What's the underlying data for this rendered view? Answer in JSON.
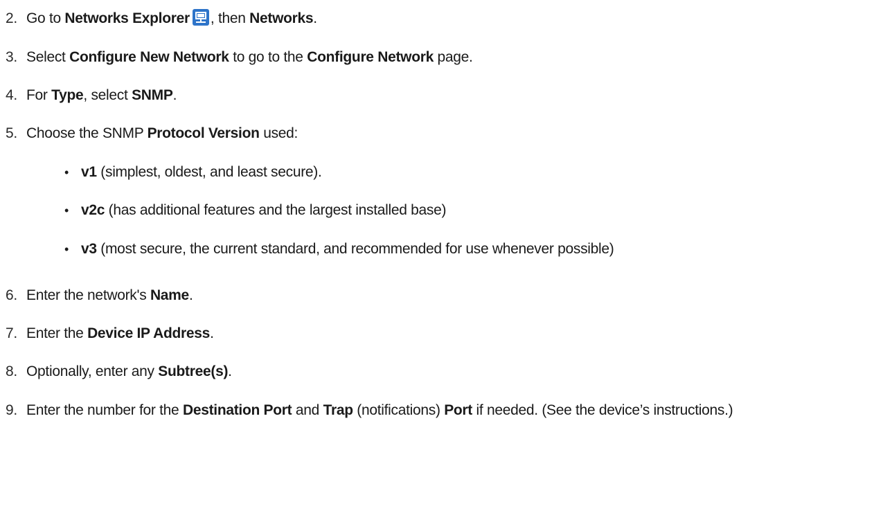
{
  "steps": [
    {
      "num": "2.",
      "parts": [
        "Go to ",
        "Networks Explorer",
        ", then ",
        "Networks",
        "."
      ]
    },
    {
      "num": "3.",
      "parts": [
        "Select ",
        "Configure New Network",
        " to go to the ",
        "Configure Network",
        " page."
      ]
    },
    {
      "num": "4.",
      "parts": [
        "For ",
        "Type",
        ", select ",
        "SNMP",
        "."
      ]
    },
    {
      "num": "5.",
      "parts": [
        "Choose the SNMP ",
        "Protocol Version",
        " used:"
      ]
    },
    {
      "num": "6.",
      "parts": [
        "Enter the network's ",
        "Name",
        "."
      ]
    },
    {
      "num": "7.",
      "parts": [
        "Enter the ",
        "Device IP Address",
        "."
      ]
    },
    {
      "num": "8.",
      "parts": [
        "Optionally, enter any ",
        "Subtree(s)",
        "."
      ]
    },
    {
      "num": "9.",
      "parts": [
        "Enter the number for the ",
        "Destination Port",
        " and ",
        "Trap",
        " (notifications) ",
        "Port",
        " if needed. (See the device’s instructions.)"
      ]
    }
  ],
  "versions": [
    {
      "name": "v1",
      "desc": " (simplest, oldest, and least secure)."
    },
    {
      "name": "v2c",
      "desc": " (has additional features and the largest installed base)"
    },
    {
      "name": "v3",
      "desc": " (most secure, the current standard, and recommended for use whenever possible)"
    }
  ],
  "bullet": "•",
  "icons": {
    "networks_explorer": "network-computer-icon"
  },
  "colors": {
    "icon_bg": "#2e74c9",
    "text": "#1a1a1a"
  }
}
